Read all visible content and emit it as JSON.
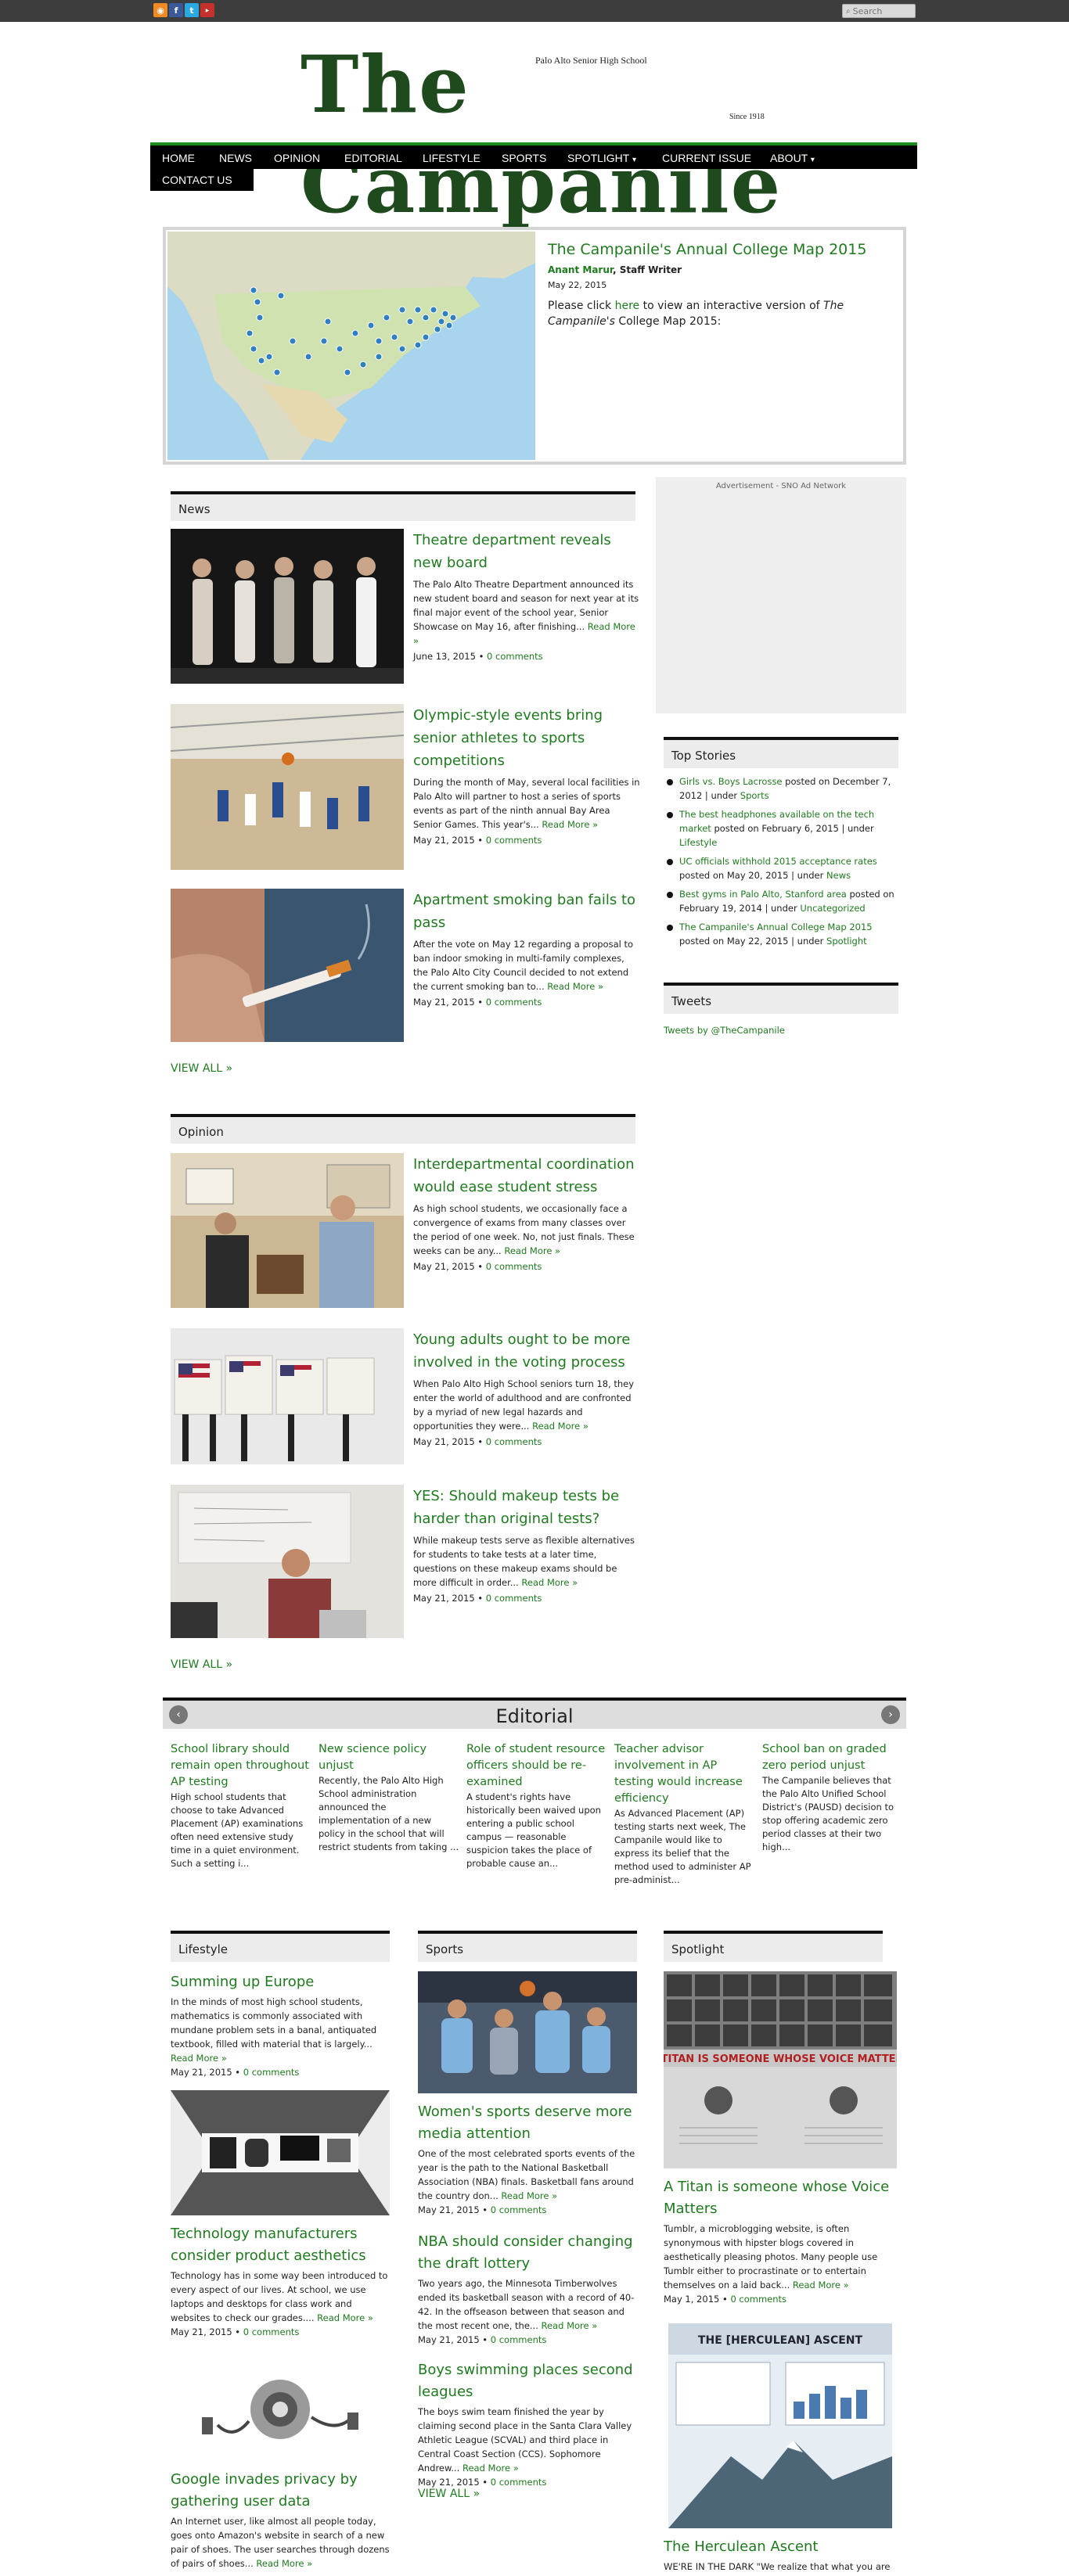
{
  "topbar": {
    "social": [
      "RSS",
      "f",
      "t",
      "You Tube"
    ],
    "search_placeholder": "Search"
  },
  "masthead": {
    "title": "The Campanile",
    "subtitle": "Palo Alto Senior High School",
    "since": "Since 1918"
  },
  "nav": {
    "items": [
      "HOME",
      "NEWS",
      "OPINION",
      "EDITORIAL",
      "LIFESTYLE",
      "SPORTS",
      "SPOTLIGHT",
      "CURRENT ISSUE",
      "ABOUT"
    ],
    "row2": [
      "CONTACT US"
    ],
    "dropdown_marker": "▾"
  },
  "featured": {
    "title": "The Campanile's Annual College Map 2015",
    "author": "Anant Marur",
    "role": ", Staff Writer",
    "date": "May 22, 2015",
    "body_pre": "Please click ",
    "body_link": "here",
    "body_mid": " to view an interactive version of ",
    "body_italic": "The Campanile's",
    "body_post": " College Map 2015:"
  },
  "labels": {
    "read_more": "Read More »",
    "comments": "0 comments",
    "view_all": "VIEW ALL »",
    "sep": " • "
  },
  "news": {
    "heading": "News",
    "stories": [
      {
        "title": "Theatre department reveals new board",
        "body": "The Palo Alto Theatre Department announced its new student board and season for next year at its final major event of the school year, Senior Showcase on May 16, after finishing...",
        "date": "June 13, 2015"
      },
      {
        "title": "Olympic-style events bring senior athletes to sports competitions",
        "body": "During the month of May, several local facilities in Palo Alto will partner to host a series of sports events as part of the ninth annual Bay Area Senior Games. This year's...",
        "date": "May 21, 2015"
      },
      {
        "title": "Apartment smoking ban fails to pass",
        "body": "After the vote on May 12 regarding a proposal to ban indoor smoking in multi-family complexes, the Palo Alto City Council decided to not extend the current smoking ban to...",
        "date": "May 21, 2015"
      }
    ]
  },
  "opinion": {
    "heading": "Opinion",
    "stories": [
      {
        "title": "Interdepartmental coordination would ease student stress",
        "body": "As high school students, we occasionally face a convergence of exams from many classes over the period of one week. No, not just finals. These weeks can be any...",
        "date": "May 21, 2015"
      },
      {
        "title": "Young adults ought to be more involved in the voting process",
        "body": "When Palo Alto High School seniors turn 18, they enter the world of adulthood and are confronted by a myriad of new legal hazards and opportunities they were...",
        "date": "May 21, 2015"
      },
      {
        "title": "YES: Should makeup tests be harder than original tests?",
        "body": "While makeup tests serve as flexible alternatives for students to take tests at a later time, questions on these makeup exams should be more difficult in order...",
        "date": "May 21, 2015"
      }
    ]
  },
  "sidebar": {
    "ad_label": "Advertisement - SNO Ad Network",
    "top_stories_heading": "Top Stories",
    "top_stories": [
      {
        "title": "Girls vs. Boys Lacrosse",
        "posted": " posted on December 7, 2012 | under ",
        "cat": "Sports"
      },
      {
        "title": "The best headphones available on the tech market",
        "posted": " posted on February 6, 2015 | under ",
        "cat": "Lifestyle"
      },
      {
        "title": "UC officials withhold 2015 acceptance rates",
        "posted": " posted on May 20, 2015 | under ",
        "cat": "News"
      },
      {
        "title": "Best gyms in Palo Alto, Stanford area",
        "posted": " posted on February 19, 2014 | under ",
        "cat": "Uncategorized"
      },
      {
        "title": "The Campanile's Annual College Map 2015",
        "posted": " posted on May 22, 2015 | under ",
        "cat": "Spotlight"
      }
    ],
    "tweets_heading": "Tweets",
    "tweets_link": "Tweets by @TheCampanile"
  },
  "editorial": {
    "heading": "Editorial",
    "prev": "‹",
    "next": "›",
    "items": [
      {
        "title": "School library should remain open throughout AP testing",
        "body": "High school students that choose to take Advanced Placement (AP) examinations often need extensive study time in a quiet environment. Such a setting i..."
      },
      {
        "title": "New science policy unjust",
        "body": "Recently, the Palo Alto High School administration announced the implementation of a new policy in the school that will restrict students from taking ..."
      },
      {
        "title": "Role of student resource officers should be re-examined",
        "body": "A student's rights have historically been waived upon entering a public school campus — reasonable suspicion takes the place of probable cause an..."
      },
      {
        "title": "Teacher advisor involvement in AP testing would increase efficiency",
        "body": "As Advanced Placement (AP) testing starts next week, The Campanile would like to express its belief that the method used to administer AP pre-administ..."
      },
      {
        "title": "School ban on graded zero period unjust",
        "body": "The Campanile believes that the Palo Alto Unified School District's (PAUSD) decision to stop offering academic zero period classes at their two high..."
      }
    ]
  },
  "lifestyle": {
    "heading": "Lifestyle",
    "stories": [
      {
        "title": "Summing up Europe",
        "body": "In the minds of most high school students, mathematics is commonly associated with mundane problem sets in a banal, antiquated textbook, filled with material that is largely...",
        "date": "May 21, 2015"
      },
      {
        "title": "Technology manufacturers consider product aesthetics",
        "body": "Technology has in some way been introduced to every aspect of our lives. At school, we use laptops and desktops for class work and websites to check our grades....",
        "date": "May 21, 2015"
      },
      {
        "title": "Google invades privacy by gathering user data",
        "body": "An Internet user, like almost all people today, goes onto Amazon's website in search of a new pair of shoes. The user searches through dozens of pairs of shoes...",
        "date": ""
      }
    ]
  },
  "sports": {
    "heading": "Sports",
    "stories": [
      {
        "title": "Women's sports deserve more media attention",
        "body": "One of the most celebrated sports events of the year is the path to the National Basketball Association (NBA) finals. Basketball fans around the country don...",
        "date": "May 21, 2015"
      },
      {
        "title": "NBA should consider changing the draft lottery",
        "body": "Two years ago, the Minnesota Timberwolves ended its basketball season with a record of 40-42. In the offseason between that season and the most recent one, the...",
        "date": "May 21, 2015"
      },
      {
        "title": "Boys swimming places second leagues",
        "body": "The boys swim team finished the year by claiming second place in the Santa Clara Valley Athletic League (SCVAL) and third place in Central Coast Section (CCS). Sophomore Andrew...",
        "date": "May 21, 2015"
      }
    ]
  },
  "spotlight": {
    "heading": "Spotlight",
    "stories": [
      {
        "title": "A Titan is someone whose Voice Matters",
        "body": "Tumblr, a microblogging website, is often synonymous with hipster blogs covered in aesthetically pleasing photos. Many people use Tumblr either to procrastinate or to entertain themselves on a laid back...",
        "date": "May 1, 2015"
      },
      {
        "title": "The Herculean Ascent",
        "body": "WE'RE IN THE DARK \"We realize that what you are all",
        "date": ""
      }
    ],
    "poster1_text": "A TITAN IS SOMEONE WHOSE VOICE MATTERS",
    "poster2_text": "THE [HERCULEAN] ASCENT"
  }
}
